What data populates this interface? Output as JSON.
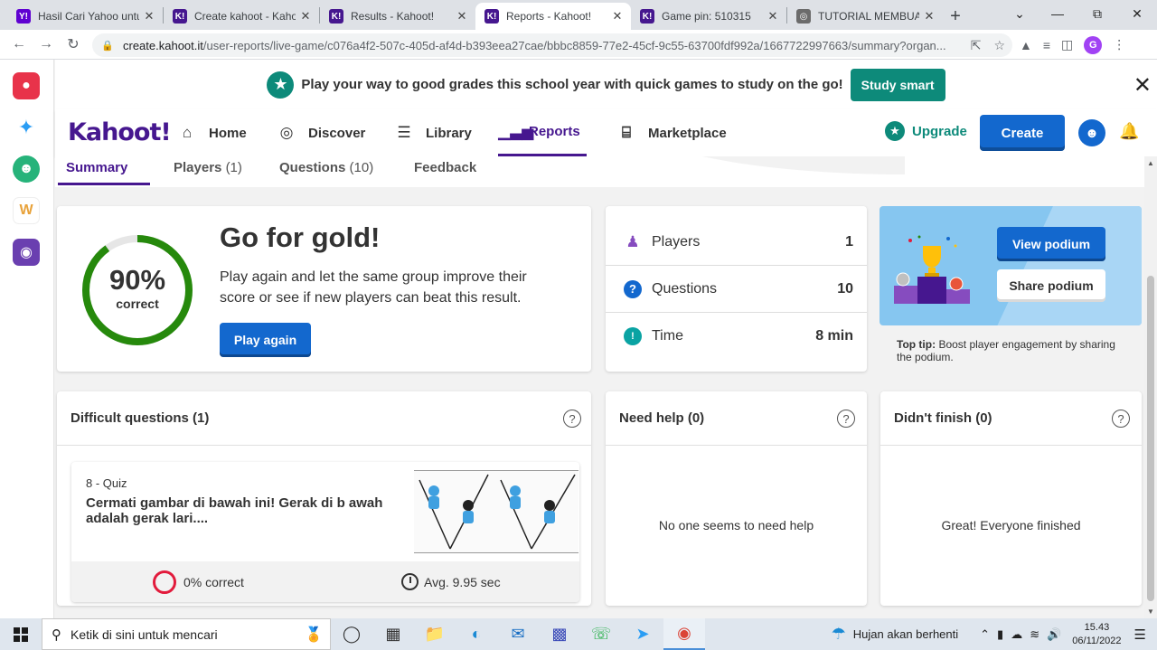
{
  "browser": {
    "tabs": [
      {
        "title": "Hasil Cari Yahoo untuk",
        "favicon": "Y!",
        "color": "#5f01d1",
        "active": false
      },
      {
        "title": "Create kahoot - Kahoot!",
        "favicon": "K!",
        "color": "#46178f",
        "active": false
      },
      {
        "title": "Results - Kahoot!",
        "favicon": "K!",
        "color": "#46178f",
        "active": false
      },
      {
        "title": "Reports - Kahoot!",
        "favicon": "K!",
        "color": "#46178f",
        "active": true
      },
      {
        "title": "Game pin: 510315",
        "favicon": "K!",
        "color": "#46178f",
        "active": false
      },
      {
        "title": "TUTORIAL MEMBUAT",
        "favicon": "◎",
        "color": "#6b6b6b",
        "active": false
      }
    ],
    "url_host": "create.kahoot.it",
    "url_path": "/user-reports/live-game/c076a4f2-507c-405d-af4d-b393eea27cae/bbbc8859-77e2-45cf-9c55-63700fdf992a/1667722997663/summary?organ...",
    "profile_letter": "G"
  },
  "promo": {
    "text": "Play your way to good grades this school year with quick games to study on the go!",
    "button": "Study smart"
  },
  "header": {
    "logo": "Kahoot!",
    "nav": [
      {
        "label": "Home",
        "icon": "⌂",
        "active": false
      },
      {
        "label": "Discover",
        "icon": "◎",
        "active": false
      },
      {
        "label": "Library",
        "icon": "☰",
        "active": false
      },
      {
        "label": "Reports",
        "icon": "▁▃▅",
        "active": true
      },
      {
        "label": "Marketplace",
        "icon": "⌸",
        "active": false
      }
    ],
    "upgrade": "Upgrade",
    "create": "Create"
  },
  "subtabs": [
    {
      "label": "Summary",
      "count": ""
    },
    {
      "label": "Players",
      "count": "(1)"
    },
    {
      "label": "Questions",
      "count": "(10)"
    },
    {
      "label": "Feedback",
      "count": ""
    }
  ],
  "summary": {
    "percent": "90%",
    "percent_value": 0.9,
    "correct_label": "correct",
    "title": "Go for gold!",
    "description": "Play again and let the same group improve their score or see if new players can beat this result.",
    "play_again": "Play again"
  },
  "stats": [
    {
      "label": "Players",
      "value": "1",
      "icon": "person-icon",
      "color": "#864cbf"
    },
    {
      "label": "Questions",
      "value": "10",
      "icon": "question-icon",
      "color": "#1368ce"
    },
    {
      "label": "Time",
      "value": "8 min",
      "icon": "clock-icon",
      "color": "#0aa3a3"
    }
  ],
  "podium": {
    "view": "View podium",
    "share": "Share podium",
    "tip_label": "Top tip:",
    "tip_text": "Boost player engagement by sharing the podium."
  },
  "difficult": {
    "title": "Difficult questions (1)",
    "question": {
      "type": "8 - Quiz",
      "text": "Cermati gambar di bawah ini! Gerak di b awah adalah gerak lari....",
      "correct": "0% correct",
      "avg": "Avg. 9.95 sec"
    }
  },
  "need_help": {
    "title": "Need help (0)",
    "message": "No one seems to need help"
  },
  "didnt_finish": {
    "title": "Didn't finish (0)",
    "message": "Great! Everyone finished"
  },
  "taskbar": {
    "search_placeholder": "Ketik di sini untuk mencari",
    "weather": "Hujan akan berhenti",
    "time": "15.43",
    "date": "06/11/2022"
  }
}
